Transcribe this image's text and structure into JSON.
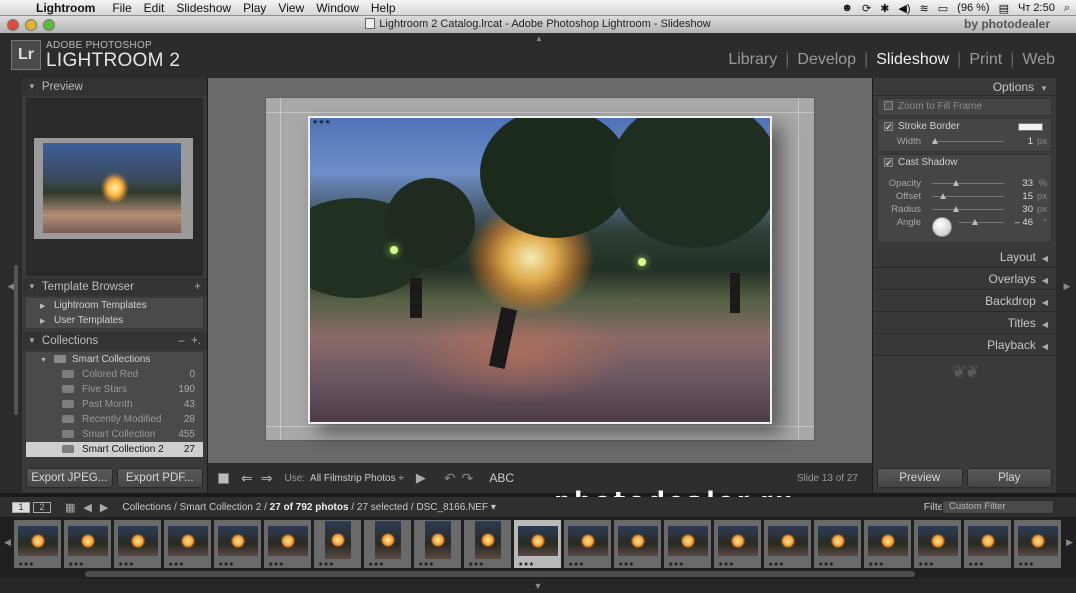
{
  "mac_menu": {
    "app": "Lightroom",
    "items": [
      "File",
      "Edit",
      "Slideshow",
      "Play",
      "View",
      "Window",
      "Help"
    ],
    "battery": "(96 %)",
    "clock": "Чт 2:50"
  },
  "window": {
    "title": "Lightroom 2 Catalog.lrcat - Adobe Photoshop Lightroom - Slideshow",
    "watermark": "by photodealer"
  },
  "identity": {
    "badge": "Lr",
    "line1": "ADOBE PHOTOSHOP",
    "line2": "LIGHTROOM 2"
  },
  "modules": {
    "library": "Library",
    "develop": "Develop",
    "slideshow": "Slideshow",
    "print": "Print",
    "web": "Web"
  },
  "left": {
    "preview_title": "Preview",
    "template_title": "Template Browser",
    "templates": [
      "Lightroom Templates",
      "User Templates"
    ],
    "collections_title": "Collections",
    "smart_collections": "Smart Collections",
    "collections": [
      {
        "name": "Colored Red",
        "count": "0"
      },
      {
        "name": "Five Stars",
        "count": "190"
      },
      {
        "name": "Past Month",
        "count": "43"
      },
      {
        "name": "Recently Modified",
        "count": "28"
      },
      {
        "name": "Smart Collection",
        "count": "455"
      },
      {
        "name": "Smart Collection 2",
        "count": "27"
      }
    ],
    "export_jpeg": "Export JPEG...",
    "export_pdf": "Export PDF..."
  },
  "toolbar": {
    "use_label": "Use:",
    "use_value": "All Filmstrip Photos ÷",
    "abc": "ABC",
    "slide_count": "Slide 13 of 27"
  },
  "right": {
    "options_title": "Options",
    "zoom_to_fill": "Zoom to Fill Frame",
    "stroke_border": "Stroke Border",
    "width_label": "Width",
    "width_value": "1",
    "width_unit": "px",
    "cast_shadow": "Cast Shadow",
    "opacity_label": "Opacity",
    "opacity_value": "33",
    "opacity_unit": "%",
    "offset_label": "Offset",
    "offset_value": "15",
    "offset_unit": "px",
    "radius_label": "Radius",
    "radius_value": "30",
    "radius_unit": "px",
    "angle_label": "Angle",
    "angle_value": "– 46",
    "angle_unit": "°",
    "sections": [
      "Layout",
      "Overlays",
      "Backdrop",
      "Titles",
      "Playback"
    ],
    "preview_btn": "Preview",
    "play_btn": "Play"
  },
  "filmstrip": {
    "screen1": "1",
    "screen2": "2",
    "path_prefix": "Collections / Smart Collection 2 /",
    "path_count": "27 of 792 photos",
    "path_suffix": "/ 27 selected / DSC_8166.NEF ▾",
    "filter_label": "Filter:",
    "filter_value": "Custom Filter",
    "watermark": "photodealer.ru",
    "thumb_count": 21,
    "selected_index": 10,
    "stars": "★★★"
  },
  "photo": {
    "stars": "★★★"
  }
}
